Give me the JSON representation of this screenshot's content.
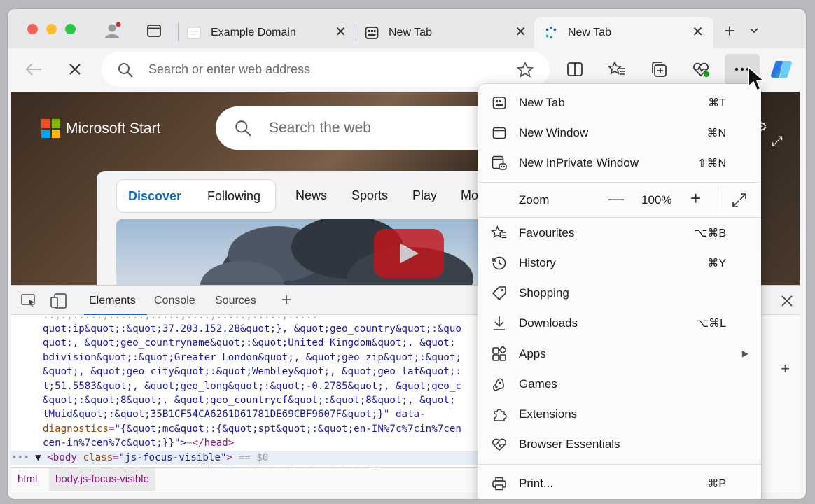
{
  "tabs": [
    {
      "title": "Example Domain",
      "favicon": "page-icon",
      "active": false
    },
    {
      "title": "New Tab",
      "favicon": "newtab-icon",
      "active": false
    },
    {
      "title": "New Tab",
      "favicon": "edge-loading-icon",
      "active": true
    }
  ],
  "address_bar": {
    "placeholder": "Search or enter web address",
    "value": ""
  },
  "page": {
    "brand": "Microsoft Start",
    "search_placeholder": "Search the web",
    "feed_tabs": [
      "Discover",
      "Following"
    ],
    "nav_links": [
      "News",
      "Sports",
      "Play",
      "Mo"
    ]
  },
  "devtools": {
    "tabs": [
      "Elements",
      "Console",
      "Sources"
    ],
    "active_tab": "Elements",
    "breadcrumbs": [
      "html",
      "body.js-focus-visible"
    ],
    "code_lines": [
      {
        "t": "quot;ip&quot;:&quot;37.203.152.28&quot;}, &quot;geo_country&quot;:&quo",
        "c": "val"
      },
      {
        "t": "quot;, &quot;geo_countryname&quot;:&quot;United Kingdom&quot;, &quot;",
        "c": "val"
      },
      {
        "t": "bdivision&quot;:&quot;Greater London&quot;, &quot;geo_zip&quot;:&quot;",
        "c": "val"
      },
      {
        "t": "&quot;, &quot;geo_city&quot;:&quot;Wembley&quot;, &quot;geo_lat&quot;:",
        "c": "val"
      },
      {
        "t": "t;51.5583&quot;, &quot;geo_long&quot;:&quot;-0.2785&quot;, &quot;geo_c",
        "c": "val"
      },
      {
        "t": "&quot;:&quot;8&quot;, &quot;geo_countrycf&quot;:&quot;8&quot;, &quot;",
        "c": "val"
      },
      {
        "t": "tMuid&quot;:&quot;35B1CF54CA6261D61781DE69CBF9607F&quot;}\" data-",
        "c": "val"
      },
      {
        "t": "diagnostics=\"{&quot;mc&quot;:{&quot;spt&quot;:&quot;en-IN%7c%7cin%7cen",
        "c": "val"
      },
      {
        "t": "cen-in%7cen%7c&quot;}}\">⋯</head>",
        "c": "val"
      }
    ],
    "body_line": {
      "tag": "<body",
      "attr": "class",
      "value": "\"js-focus-visible\"",
      "close": ">",
      "suffix": "== $0"
    }
  },
  "menu": {
    "items": [
      {
        "label": "New Tab",
        "shortcut": "⌘T",
        "icon": "new-tab-icon"
      },
      {
        "label": "New Window",
        "shortcut": "⌘N",
        "icon": "new-window-icon"
      },
      {
        "label": "New InPrivate Window",
        "shortcut": "⇧⌘N",
        "icon": "inprivate-icon"
      }
    ],
    "zoom": {
      "label": "Zoom",
      "value": "100%",
      "minus": "—",
      "plus": "+"
    },
    "items2": [
      {
        "label": "Favourites",
        "shortcut": "⌥⌘B",
        "icon": "favourites-icon"
      },
      {
        "label": "History",
        "shortcut": "⌘Y",
        "icon": "history-icon"
      },
      {
        "label": "Shopping",
        "shortcut": "",
        "icon": "shopping-tag-icon"
      },
      {
        "label": "Downloads",
        "shortcut": "⌥⌘L",
        "icon": "download-icon"
      },
      {
        "label": "Apps",
        "shortcut": "",
        "icon": "apps-icon"
      },
      {
        "label": "Games",
        "shortcut": "",
        "icon": "games-icon"
      },
      {
        "label": "Extensions",
        "shortcut": "",
        "icon": "extensions-icon"
      },
      {
        "label": "Browser Essentials",
        "shortcut": "",
        "icon": "browser-essentials-icon"
      }
    ],
    "print": {
      "label": "Print...",
      "shortcut": "⌘P"
    }
  },
  "colors": {
    "accent": "#0f6cbd",
    "tag": "#881280",
    "attr": "#994500",
    "value": "#1a1aa6"
  }
}
